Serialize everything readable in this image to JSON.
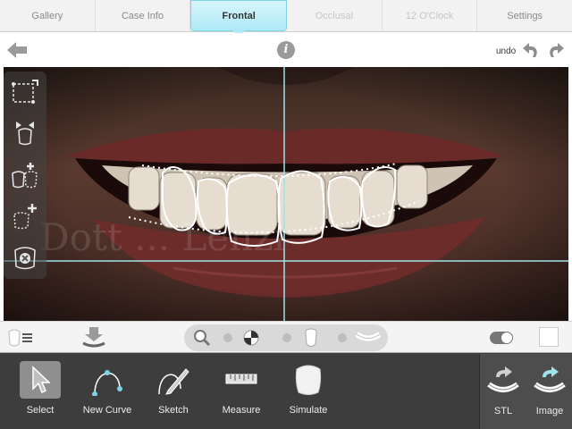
{
  "tabs": [
    {
      "label": "Gallery",
      "state": "normal"
    },
    {
      "label": "Case Info",
      "state": "normal"
    },
    {
      "label": "Frontal",
      "state": "active"
    },
    {
      "label": "Occlusal",
      "state": "disabled"
    },
    {
      "label": "12 O'Clock",
      "state": "disabled"
    },
    {
      "label": "Settings",
      "state": "normal"
    }
  ],
  "nav": {
    "back_icon": "back-arrow-icon",
    "info_icon": "info-icon",
    "info_glyph": "i",
    "undo_label": "undo"
  },
  "photo": {
    "watermark": "Dott ... Lenzi"
  },
  "left_tools": [
    "select-region-icon",
    "move-points-icon",
    "add-teeth-icon",
    "add-curve-icon",
    "delete-icon"
  ],
  "tools": [
    {
      "label": "Select",
      "icon": "select-arrow-icon",
      "selected": true
    },
    {
      "label": "New Curve",
      "icon": "new-curve-icon",
      "selected": false
    },
    {
      "label": "Sketch",
      "icon": "sketch-icon",
      "selected": false
    },
    {
      "label": "Measure",
      "icon": "measure-icon",
      "selected": false
    },
    {
      "label": "Simulate",
      "icon": "simulate-tooth-icon",
      "selected": false
    }
  ],
  "export_tools": [
    {
      "label": "STL",
      "icon": "stl-export-icon"
    },
    {
      "label": "Image",
      "icon": "image-export-icon"
    }
  ],
  "colors": {
    "active_tab": "#aee9f6",
    "guide_line": "#9fe3e8",
    "dock_bg": "#3d3d3d"
  }
}
